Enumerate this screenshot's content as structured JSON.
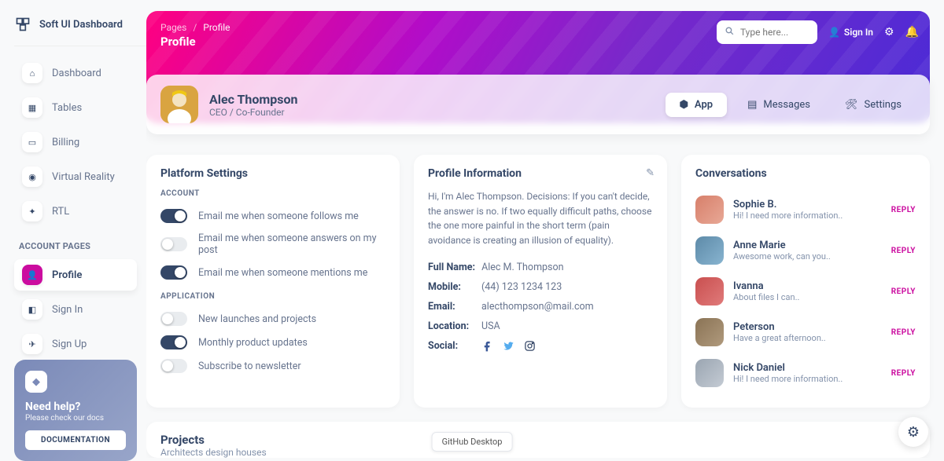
{
  "brand": {
    "name": "Soft UI Dashboard"
  },
  "sidebar": {
    "items": [
      {
        "label": "Dashboard"
      },
      {
        "label": "Tables"
      },
      {
        "label": "Billing"
      },
      {
        "label": "Virtual Reality"
      },
      {
        "label": "RTL"
      }
    ],
    "section_label": "ACCOUNT PAGES",
    "account_items": [
      {
        "label": "Profile"
      },
      {
        "label": "Sign In"
      },
      {
        "label": "Sign Up"
      }
    ]
  },
  "help": {
    "title": "Need help?",
    "subtitle": "Please check our docs",
    "button": "DOCUMENTATION"
  },
  "breadcrumbs": {
    "root": "Pages",
    "current": "Profile",
    "title": "Profile"
  },
  "topbar": {
    "search_placeholder": "Type here...",
    "signin": "Sign In"
  },
  "profile": {
    "name": "Alec Thompson",
    "role": "CEO / Co-Founder",
    "tabs": [
      {
        "label": "App"
      },
      {
        "label": "Messages"
      },
      {
        "label": "Settings"
      }
    ]
  },
  "platform": {
    "title": "Platform Settings",
    "sections": {
      "account": {
        "label": "ACCOUNT",
        "items": [
          {
            "label": "Email me when someone follows me",
            "on": true
          },
          {
            "label": "Email me when someone answers on my post",
            "on": false
          },
          {
            "label": "Email me when someone mentions me",
            "on": true
          }
        ]
      },
      "application": {
        "label": "APPLICATION",
        "items": [
          {
            "label": "New launches and projects",
            "on": false
          },
          {
            "label": "Monthly product updates",
            "on": true
          },
          {
            "label": "Subscribe to newsletter",
            "on": false
          }
        ]
      }
    }
  },
  "info": {
    "title": "Profile Information",
    "bio": "Hi, I'm Alec Thompson. Decisions: If you can't decide, the answer is no. If two equally difficult paths, choose the one more painful in the short term (pain avoidance is creating an illusion of equality).",
    "fields": {
      "full_name": {
        "k": "Full Name:",
        "v": "Alec M. Thompson"
      },
      "mobile": {
        "k": "Mobile:",
        "v": "(44) 123 1234 123"
      },
      "email": {
        "k": "Email:",
        "v": "alecthompson@mail.com"
      },
      "location": {
        "k": "Location:",
        "v": "USA"
      },
      "social": {
        "k": "Social:"
      }
    }
  },
  "conversations": {
    "title": "Conversations",
    "items": [
      {
        "name": "Sophie B.",
        "msg": "Hi! I need more information..",
        "reply": "REPLY"
      },
      {
        "name": "Anne Marie",
        "msg": "Awesome work, can you..",
        "reply": "REPLY"
      },
      {
        "name": "Ivanna",
        "msg": "About files I can..",
        "reply": "REPLY"
      },
      {
        "name": "Peterson",
        "msg": "Have a great afternoon..",
        "reply": "REPLY"
      },
      {
        "name": "Nick Daniel",
        "msg": "Hi! I need more information..",
        "reply": "REPLY"
      }
    ]
  },
  "projects": {
    "title": "Projects",
    "subtitle": "Architects design houses"
  },
  "bottom_pill": "GitHub Desktop"
}
